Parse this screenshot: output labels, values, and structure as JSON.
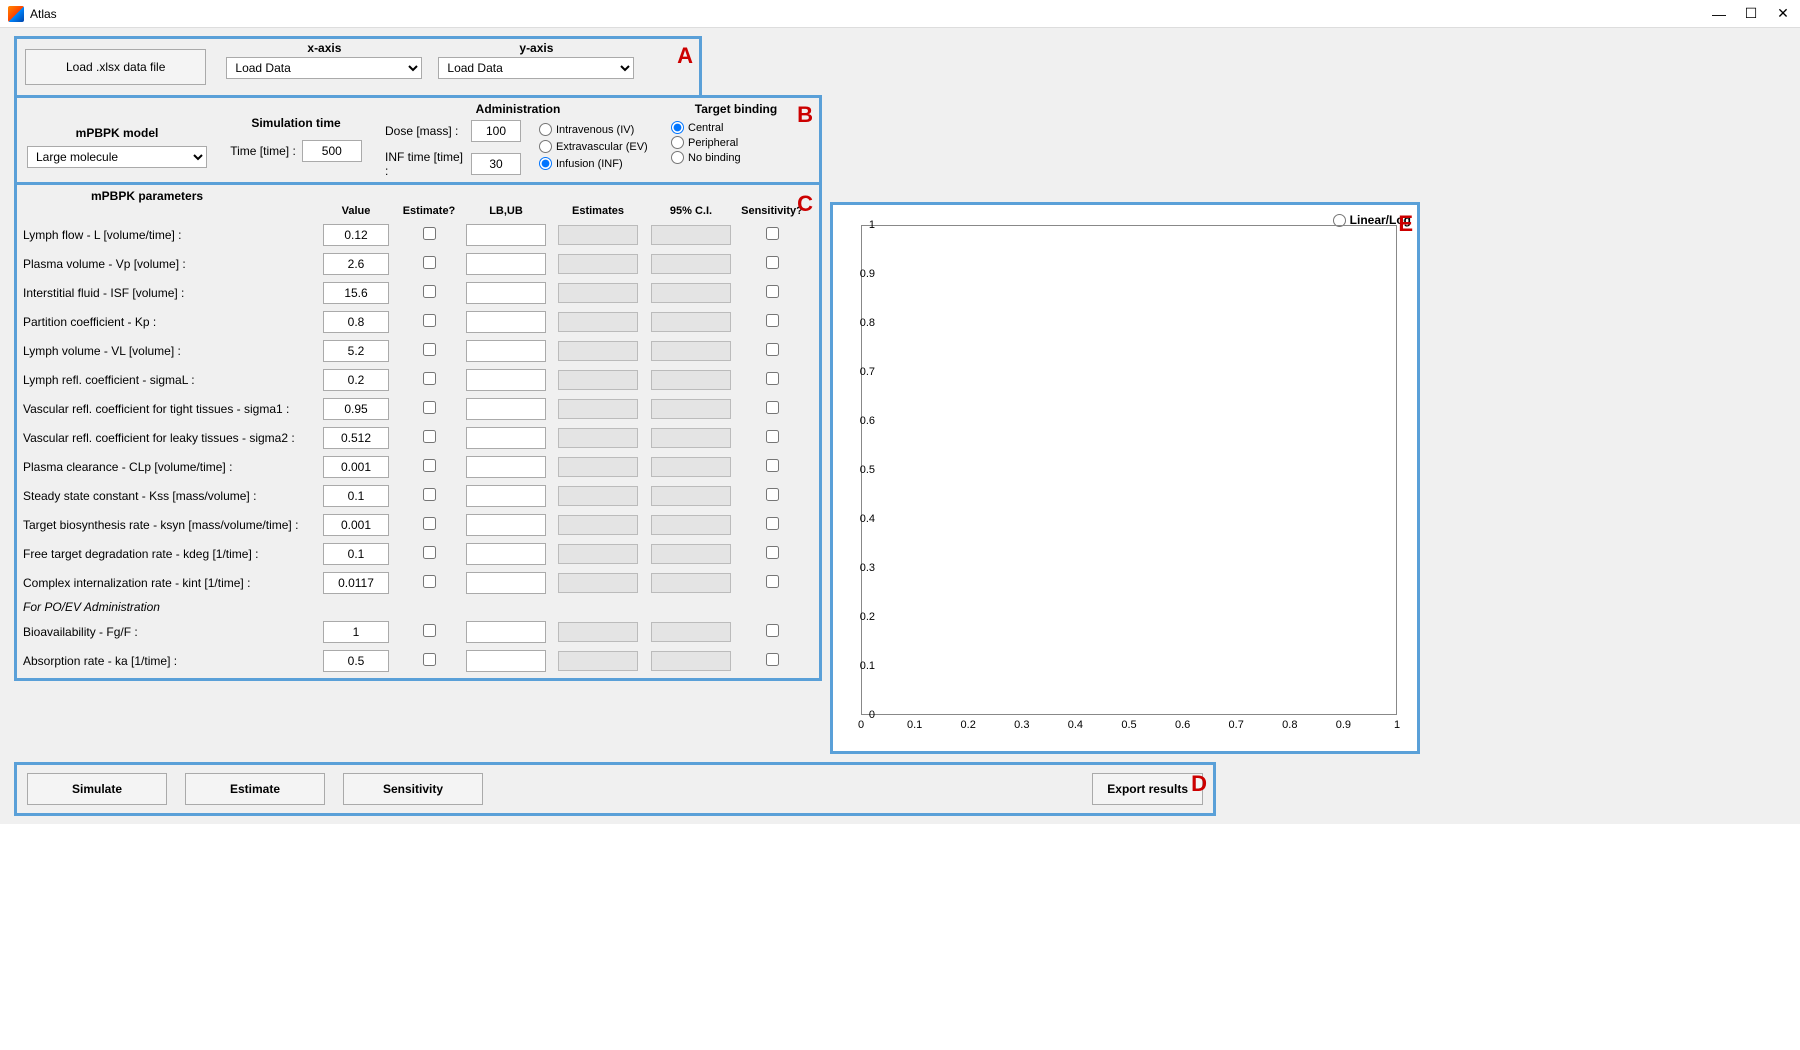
{
  "app_title": "Atlas",
  "window_controls": {
    "min": "—",
    "max": "☐",
    "close": "✕"
  },
  "sectionA": {
    "load_btn": "Load .xlsx data file",
    "x_label": "x-axis",
    "y_label": "y-axis",
    "x_value": "Load Data",
    "y_value": "Load Data",
    "tag": "A"
  },
  "sectionB": {
    "model_heading": "mPBPK model",
    "model_value": "Large molecule",
    "simtime_heading": "Simulation time",
    "simtime_label": "Time [time] :",
    "simtime_value": "500",
    "admin_heading": "Administration",
    "dose_label": "Dose [mass] :",
    "dose_value": "100",
    "inf_label": "INF time [time] :",
    "inf_value": "30",
    "admin_opts": [
      "Intravenous (IV)",
      "Extravascular (EV)",
      "Infusion (INF)"
    ],
    "admin_selected": 2,
    "binding_heading": "Target binding",
    "binding_opts": [
      "Central",
      "Peripheral",
      "No binding"
    ],
    "binding_selected": 0,
    "tag": "B"
  },
  "sectionC": {
    "heading": "mPBPK parameters",
    "cols": [
      "Value",
      "Estimate?",
      "LB,UB",
      "Estimates",
      "95% C.I.",
      "Sensitivity?"
    ],
    "params": [
      {
        "name": "Lymph flow - L [volume/time] :",
        "value": "0.12"
      },
      {
        "name": "Plasma volume - Vp [volume] :",
        "value": "2.6"
      },
      {
        "name": "Interstitial fluid - ISF [volume] :",
        "value": "15.6"
      },
      {
        "name": "Partition coefficient - Kp :",
        "value": "0.8"
      },
      {
        "name": "Lymph volume - VL [volume] :",
        "value": "5.2"
      },
      {
        "name": "Lymph refl. coefficient - sigmaL :",
        "value": "0.2"
      },
      {
        "name": "Vascular refl. coefficient for tight tissues - sigma1 :",
        "value": "0.95"
      },
      {
        "name": "Vascular refl. coefficient for leaky tissues - sigma2 :",
        "value": "0.512"
      },
      {
        "name": "Plasma clearance - CLp [volume/time] :",
        "value": "0.001"
      },
      {
        "name": "Steady state constant - Kss [mass/volume] :",
        "value": "0.1"
      },
      {
        "name": "Target biosynthesis rate - ksyn [mass/volume/time] :",
        "value": "0.001"
      },
      {
        "name": "Free target degradation rate - kdeg [1/time] :",
        "value": "0.1"
      },
      {
        "name": "Complex internalization rate - kint [1/time] :",
        "value": "0.0117"
      }
    ],
    "po_heading": "For PO/EV Administration",
    "po_params": [
      {
        "name": "Bioavailability - Fg/F :",
        "value": "1"
      },
      {
        "name": "Absorption rate - ka [1/time] :",
        "value": "0.5"
      }
    ],
    "tag": "C"
  },
  "sectionD": {
    "buttons": [
      "Simulate",
      "Estimate",
      "Sensitivity"
    ],
    "export_btn": "Export results",
    "tag": "D"
  },
  "sectionE": {
    "linlog": "Linear/Log",
    "yticks": [
      "1",
      "0.9",
      "0.8",
      "0.7",
      "0.6",
      "0.5",
      "0.4",
      "0.3",
      "0.2",
      "0.1",
      "0"
    ],
    "xticks": [
      "0",
      "0.1",
      "0.2",
      "0.3",
      "0.4",
      "0.5",
      "0.6",
      "0.7",
      "0.8",
      "0.9",
      "1"
    ],
    "tag": "E"
  },
  "chart_data": {
    "type": "line",
    "series": [],
    "xlabel": "",
    "ylabel": "",
    "xlim": [
      0,
      1
    ],
    "ylim": [
      0,
      1
    ],
    "title": ""
  }
}
